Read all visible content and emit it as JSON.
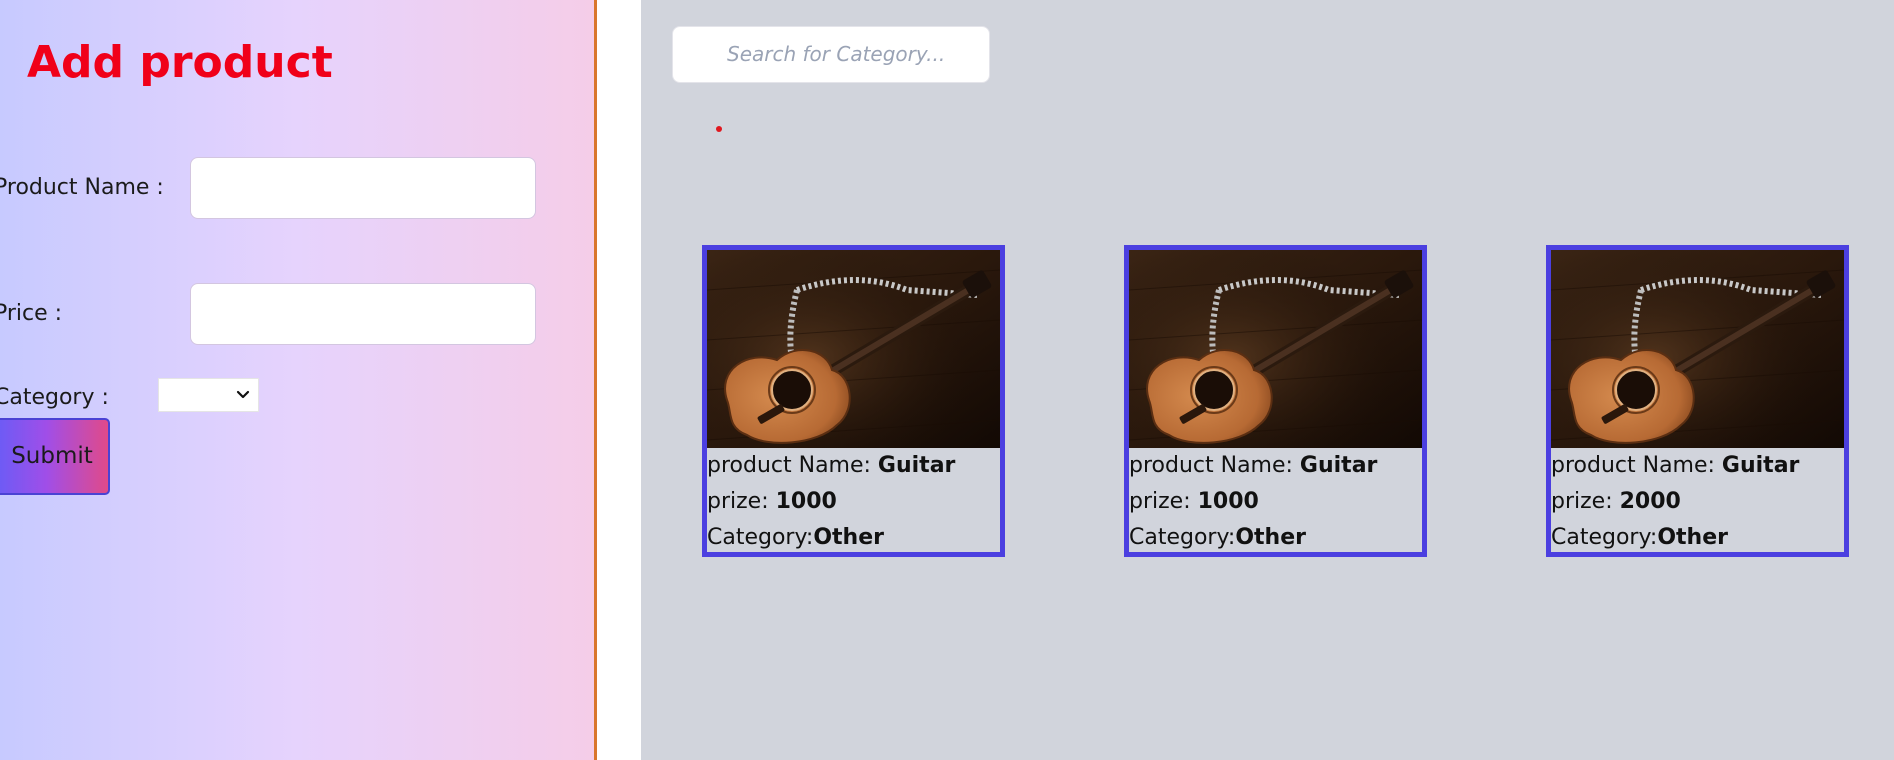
{
  "form": {
    "title": "Add product",
    "product_name_label": "Product Name :",
    "product_name_value": "",
    "price_label": "Price :",
    "price_value": "",
    "category_label": "Category :",
    "category_selected": "",
    "submit_label": "Submit"
  },
  "search": {
    "placeholder": "Search for Category..."
  },
  "colors": {
    "title": "#f00019",
    "card_border": "#4b3fe0",
    "divider": "#d9762c"
  },
  "products": [
    {
      "name_label": "product Name: ",
      "name": "Guitar",
      "prize_label": "prize: ",
      "prize": "1000",
      "category_label": "Category:",
      "category": "Other",
      "image_icon": "guitar-image"
    },
    {
      "name_label": "product Name: ",
      "name": "Guitar",
      "prize_label": "prize: ",
      "prize": "1000",
      "category_label": "Category:",
      "category": "Other",
      "image_icon": "guitar-image"
    },
    {
      "name_label": "product Name: ",
      "name": "Guitar",
      "prize_label": "prize: ",
      "prize": "2000",
      "category_label": "Category:",
      "category": "Other",
      "image_icon": "guitar-image"
    }
  ]
}
